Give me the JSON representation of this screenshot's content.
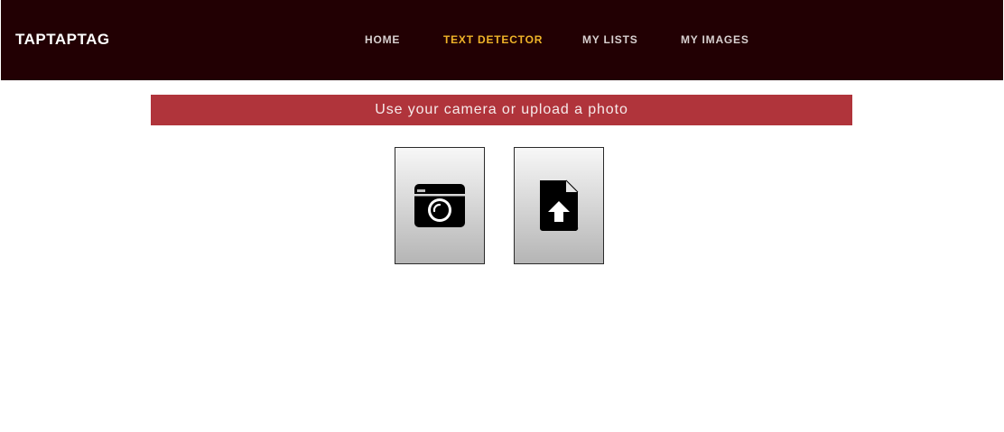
{
  "header": {
    "brand": "TAPTAPTAG",
    "nav": [
      {
        "label": "HOME",
        "active": false
      },
      {
        "label": "TEXT DETECTOR",
        "active": true
      },
      {
        "label": "MY LISTS",
        "active": false
      },
      {
        "label": "MY IMAGES",
        "active": false
      }
    ]
  },
  "main": {
    "banner_text": "Use your camera or upload a photo",
    "actions": [
      {
        "name": "camera",
        "icon": "camera-icon"
      },
      {
        "name": "upload",
        "icon": "file-upload-icon"
      }
    ]
  },
  "colors": {
    "navbar_bg": "#220003",
    "active_link": "#f0b429",
    "banner_bg": "#b0343b"
  }
}
